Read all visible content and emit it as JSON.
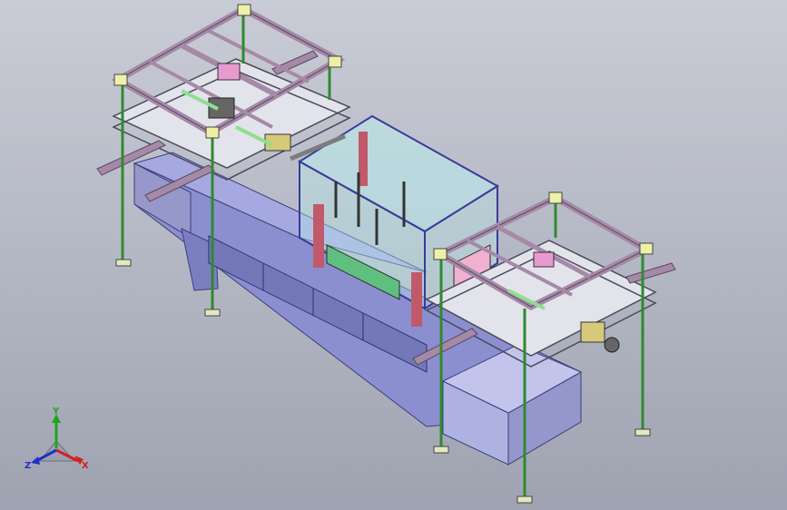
{
  "viewport": {
    "background_top": "#c9ccd6",
    "background_bottom": "#9fa3b1"
  },
  "model": {
    "frame_color": "#a58aa8",
    "frame_edge_color": "#5a4960",
    "table_color": "#e3e3ec",
    "base_color": "#8b8fcf",
    "leg_color": "#2f8a2f",
    "housing_color": "#b9ecec",
    "accent_color": "#c05a6a"
  },
  "triad": {
    "x_label": "X",
    "y_label": "Y",
    "z_label": "Z",
    "x_color": "#d42020",
    "y_color": "#1fa51f",
    "z_color": "#2030c8"
  }
}
